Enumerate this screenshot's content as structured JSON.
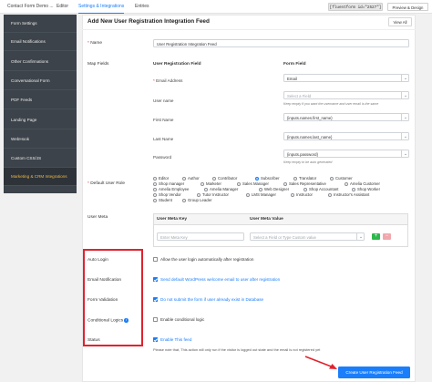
{
  "topbar": {
    "form_name": "Contact Form Demo ...",
    "tabs": [
      "Editor",
      "Settings & Integrations",
      "Entries"
    ],
    "shortcode": "[fluentform id=\"2527\"]",
    "preview_label": "Preview & Design"
  },
  "sidebar": {
    "items": [
      {
        "label": "Form Settings"
      },
      {
        "label": "Email Notifications"
      },
      {
        "label": "Other Confirmations"
      },
      {
        "label": "Conversational Form"
      },
      {
        "label": "PDF Feeds"
      },
      {
        "label": "Landing Page"
      },
      {
        "label": "WebHook"
      },
      {
        "label": "Custom CSS/JS"
      },
      {
        "label": "Marketing & CRM Integrations"
      }
    ],
    "active_index": 8
  },
  "panel": {
    "title": "Add New User Registration Integration Feed",
    "view_all_label": "View All",
    "name_label": "Name",
    "name_value": "User Registration Integration Feed",
    "map_fields_label": "Map Fields",
    "col_user_reg_field": "User Registration Field",
    "col_form_field": "Form Field",
    "fields": [
      {
        "label": "Email Address",
        "required": true,
        "value": "Email",
        "placeholder": false,
        "hint": ""
      },
      {
        "label": "User name",
        "required": false,
        "value": "Select a Field",
        "placeholder": true,
        "hint": "Keep empty if you want the username and user email is the same"
      },
      {
        "label": "First Name",
        "required": false,
        "value": "{inputs.names.first_name}",
        "placeholder": false,
        "hint": ""
      },
      {
        "label": "Last Name",
        "required": false,
        "value": "{inputs.names.last_name}",
        "placeholder": false,
        "hint": ""
      },
      {
        "label": "Password",
        "required": false,
        "value": "{inputs.password}",
        "placeholder": false,
        "hint": "Keep empty to be auto generated"
      }
    ],
    "default_role_label": "Default User Role",
    "roles": [
      "Editor",
      "Author",
      "Contributor",
      "Subscriber",
      "Translator",
      "Customer",
      "Shop manager",
      "Marketer",
      "Sales Manager",
      "Sales Representative",
      "Amelia Customer",
      "Amelia Employee",
      "Amelia Manager",
      "Web Designer",
      "Shop Accountant",
      "Shop Worker",
      "Shop Vendor",
      "Tutor Instructor",
      "LMS Manager",
      "Instructor",
      "Instructor's Assistant",
      "Student",
      "Group Leader"
    ],
    "selected_role": "Subscriber",
    "user_meta_label": "User Meta",
    "meta_col_key": "User Meta Key",
    "meta_col_value": "User Meta Value",
    "meta_key_placeholder": "Enter Meta Key",
    "meta_value_placeholder": "Select a Field or Type Custom value",
    "auto_login_label": "Auto Login",
    "auto_login_text": "Allow the user login automatically after registration",
    "email_notification_label": "Email Notification",
    "email_notification_text": "Send default WordPress welcome email to user after registration",
    "form_validation_label": "Form Validation",
    "form_validation_text": "Do not submit the form if user already exist in Database",
    "conditional_logics_label": "Conditional Logics",
    "conditional_logics_text": "Enable conditional logic",
    "status_label": "Status",
    "status_text": "Enable This feed",
    "note": "Please note that, This action will only run if the visitor is logged out state and the email is not registered yet",
    "create_button": "Create User Registration Feed"
  },
  "colors": {
    "accent": "#1a7efb",
    "sidebar_bg": "#3c434a",
    "highlight_border": "#e0232e",
    "active_sidebar_text": "#f0b849"
  }
}
